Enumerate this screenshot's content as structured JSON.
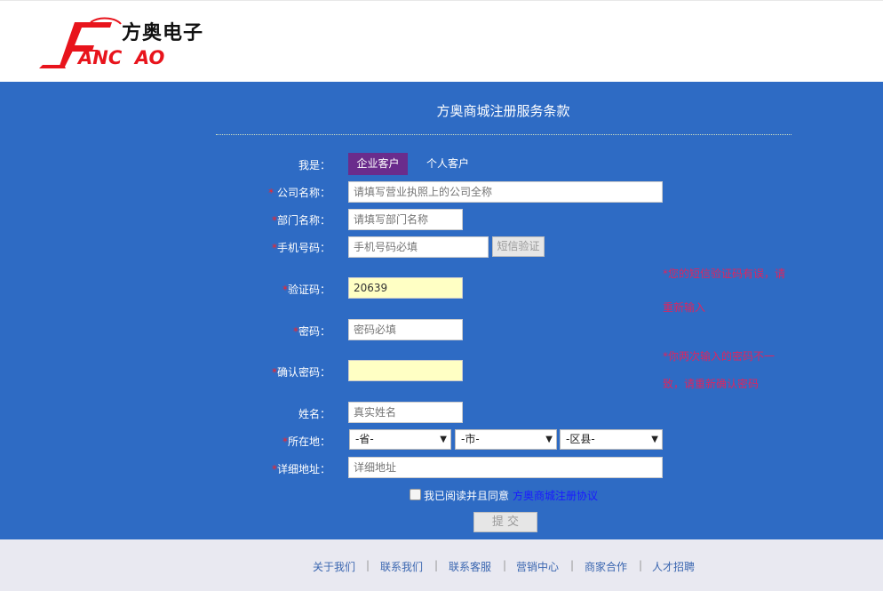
{
  "logo": {
    "cn_text": "方奥电子",
    "en_text": "ANC  AO"
  },
  "page_title": "方奥商城注册服务条款",
  "customer_type": {
    "label": "我是：",
    "options": [
      "企业客户",
      "个人客户"
    ],
    "selected": "企业客户"
  },
  "fields": {
    "company": {
      "label": "公司名称：",
      "placeholder": "请填写营业执照上的公司全称",
      "value": ""
    },
    "dept": {
      "label": "部门名称：",
      "placeholder": "请填写部门名称",
      "value": ""
    },
    "phone": {
      "label": "手机号码：",
      "placeholder": "手机号码必填",
      "value": "",
      "sms_button": "短信验证"
    },
    "code": {
      "label": "验证码：",
      "value": "20639"
    },
    "password": {
      "label": "密码：",
      "placeholder": "密码必填",
      "value": ""
    },
    "confirm": {
      "label": "确认密码：",
      "placeholder": "",
      "value": ""
    },
    "name": {
      "label": "姓名：",
      "placeholder": "真实姓名",
      "value": ""
    },
    "location": {
      "label": "所在地：",
      "province": "-省-",
      "city": "-市-",
      "district": "-区县-"
    },
    "address": {
      "label": "详细地址：",
      "placeholder": "详细地址",
      "value": ""
    }
  },
  "errors": {
    "code_line1": "*您的短信验证码有误，请",
    "code_line2": "重新输入",
    "pwd_line1": "*你两次输入的密码不一",
    "pwd_line2": "致，请重新确认密码"
  },
  "agreement": {
    "text": "我已阅读并且同意",
    "link": "方奥商城注册协议",
    "checked": false
  },
  "submit_label": "提 交",
  "footer_links": [
    "关于我们",
    "联系我们",
    "联系客服",
    "营销中心",
    "商家合作",
    "人才招聘"
  ],
  "colors": {
    "band": "#2e6bc4",
    "accent_purple": "#6a2c8c",
    "error": "#e0245e",
    "required": "#ff2020",
    "logo_red": "#e8141c"
  }
}
